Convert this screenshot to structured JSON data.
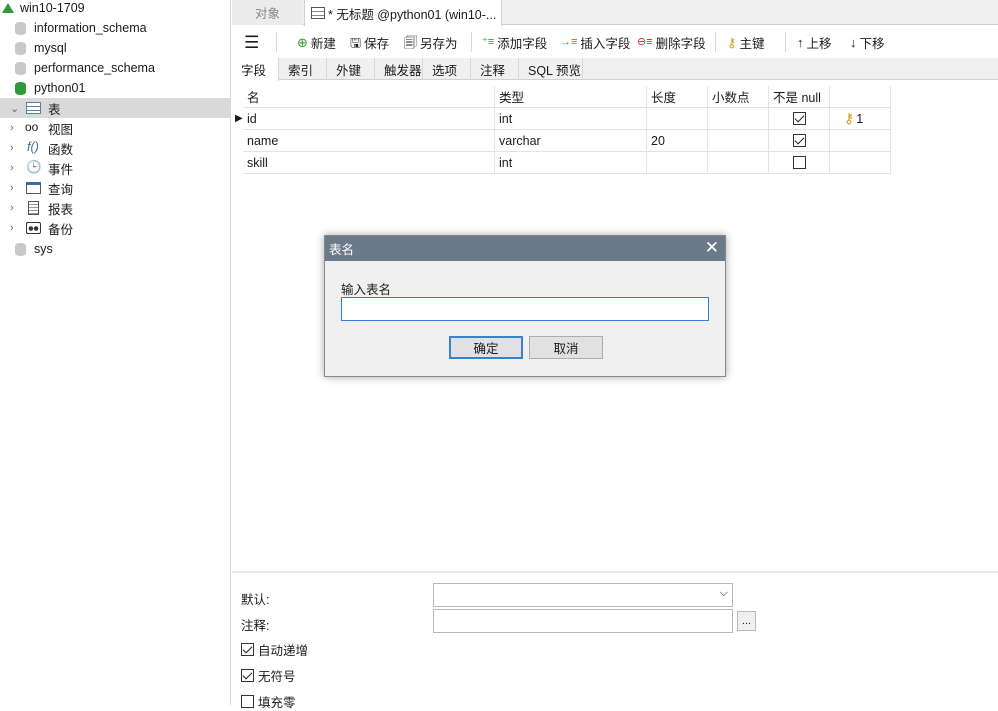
{
  "sidebar": {
    "connection": "win10-1709",
    "databases": [
      "information_schema",
      "mysql",
      "performance_schema",
      "python01"
    ],
    "python01_children": [
      "表",
      "视图",
      "函数",
      "事件",
      "查询",
      "报表",
      "备份"
    ],
    "last_db": "sys"
  },
  "tabs": {
    "objects": "对象",
    "active": "* 无标题 @python01 (win10-..."
  },
  "toolbar": {
    "new": "新建",
    "save": "保存",
    "save_as": "另存为",
    "add_field": "添加字段",
    "insert_field": "插入字段",
    "delete_field": "删除字段",
    "primary_key": "主键",
    "move_up": "上移",
    "move_down": "下移"
  },
  "subtabs": [
    "字段",
    "索引",
    "外键",
    "触发器",
    "选项",
    "注释",
    "SQL 预览"
  ],
  "grid": {
    "headers": [
      "名",
      "类型",
      "长度",
      "小数点",
      "不是 null"
    ],
    "rows": [
      {
        "name": "id",
        "type": "int",
        "length": "",
        "decimals": "",
        "not_null": true,
        "key": "1"
      },
      {
        "name": "name",
        "type": "varchar",
        "length": "20",
        "decimals": "",
        "not_null": true,
        "key": ""
      },
      {
        "name": "skill",
        "type": "int",
        "length": "",
        "decimals": "",
        "not_null": false,
        "key": ""
      }
    ]
  },
  "props": {
    "default_label": "默认:",
    "comment_label": "注释:",
    "ellipsis": "...",
    "auto_increment": "自动递增",
    "unsigned": "无符号",
    "zerofill": "填充零"
  },
  "dialog": {
    "title": "表名",
    "prompt": "输入表名",
    "input_value": "",
    "ok": "确定",
    "cancel": "取消"
  }
}
